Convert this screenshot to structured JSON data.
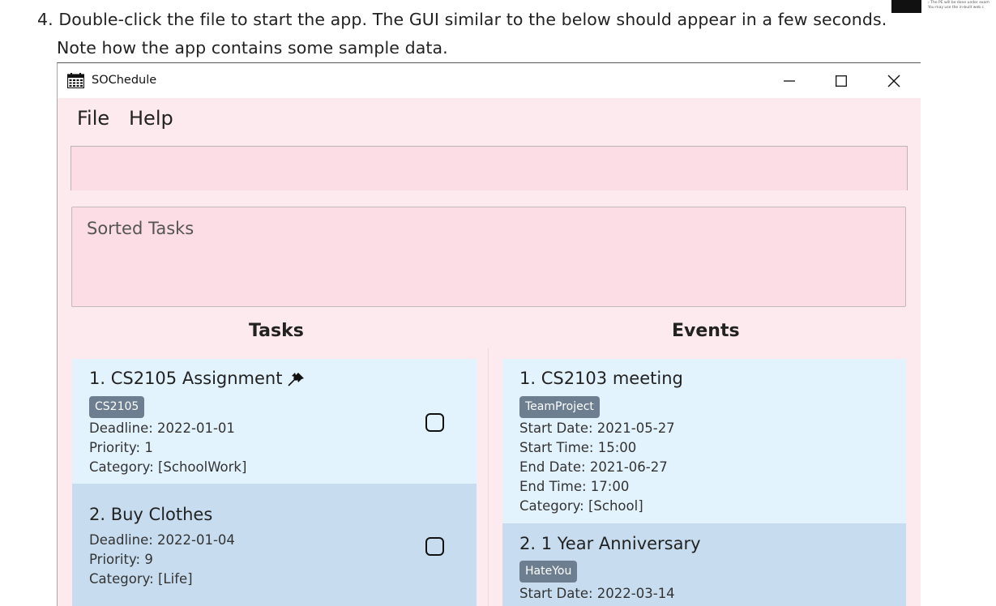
{
  "doc": {
    "line1": "4. Double-click the file to start the app. The GUI similar to the below should appear in a few seconds.",
    "line2": "Note how the app contains some sample data.",
    "thumb_line1": "›  The PE will be done under exam",
    "thumb_line2": "You may use the in-built web c"
  },
  "window": {
    "title": "SOChedule",
    "icon": "calendar-icon",
    "controls": {
      "minimize": "—",
      "maximize": "☐",
      "close": "✕"
    }
  },
  "menu": {
    "file": "File",
    "help": "Help"
  },
  "command_box": {
    "value": "",
    "placeholder": ""
  },
  "result": {
    "text": "Sorted Tasks"
  },
  "tasks_panel": {
    "title": "Tasks",
    "items": [
      {
        "title": "1.  CS2105 Assignment",
        "pinned": true,
        "tag": "CS2105",
        "deadline": "Deadline: 2022-01-01",
        "priority": "Priority: 1",
        "category": "Category: [SchoolWork]",
        "completed": false
      },
      {
        "title": "2.  Buy Clothes",
        "pinned": false,
        "tag": "",
        "deadline": "Deadline: 2022-01-04",
        "priority": "Priority: 9",
        "category": "Category: [Life]",
        "completed": false
      }
    ]
  },
  "events_panel": {
    "title": "Events",
    "items": [
      {
        "title": "1.  CS2103 meeting",
        "tag": "TeamProject",
        "start_date": "Start Date: 2021-05-27",
        "start_time": "Start Time: 15:00",
        "end_date": "End Date: 2021-06-27",
        "end_time": "End Time: 17:00",
        "category": "Category: [School]"
      },
      {
        "title": "2.  1 Year Anniversary",
        "tag": "HateYou",
        "start_date": "Start Date: 2022-03-14"
      }
    ]
  },
  "colors": {
    "window_bg": "#fceaee",
    "input_bg": "#fcdde5",
    "card_light": "#e3f3fd",
    "card_dark": "#c7ddef",
    "tag_bg": "#6d7e91"
  }
}
